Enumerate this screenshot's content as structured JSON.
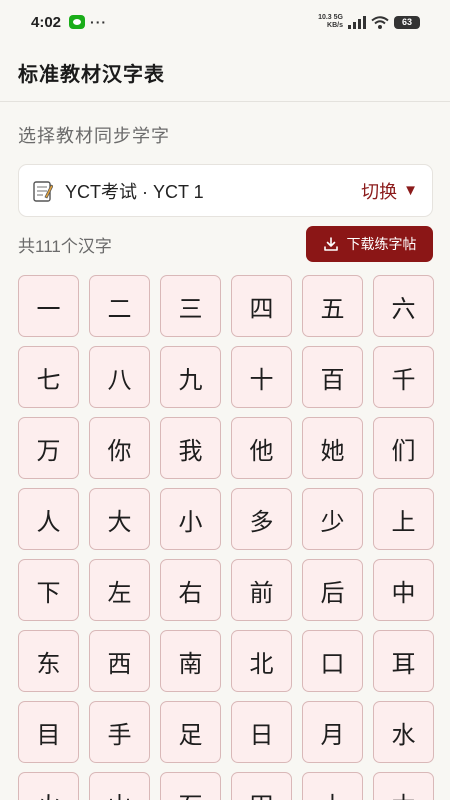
{
  "status_bar": {
    "time": "4:02",
    "more": "···",
    "net_speed_value": "10.3 5G",
    "net_speed_unit": "KB/s",
    "battery": "63"
  },
  "header": {
    "title": "标准教材汉字表"
  },
  "textbook": {
    "section_label": "选择教材同步学字",
    "selected": "YCT考试 · YCT 1",
    "switch_label": "切换",
    "switch_arrow": "▼"
  },
  "summary": {
    "count_text": "共111个汉字",
    "download_label": "下载练字帖"
  },
  "characters": [
    "一",
    "二",
    "三",
    "四",
    "五",
    "六",
    "七",
    "八",
    "九",
    "十",
    "百",
    "千",
    "万",
    "你",
    "我",
    "他",
    "她",
    "们",
    "人",
    "大",
    "小",
    "多",
    "少",
    "上",
    "下",
    "左",
    "右",
    "前",
    "后",
    "中",
    "东",
    "西",
    "南",
    "北",
    "口",
    "耳",
    "目",
    "手",
    "足",
    "日",
    "月",
    "水",
    "火",
    "山",
    "石",
    "田",
    "土",
    "木"
  ],
  "colors": {
    "accent": "#8b1616",
    "cell_bg": "#fdeeee",
    "cell_border": "#d9b8b8",
    "background": "#f8f7f3"
  }
}
